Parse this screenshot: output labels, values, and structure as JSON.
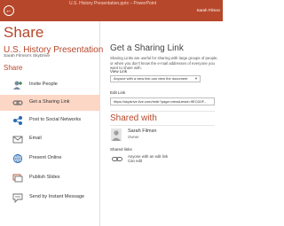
{
  "titlebar": {
    "doc_title": "U.S. History Presentation.pptx – PowerPoint",
    "user": "Sarah Filmsn"
  },
  "sidebar": {
    "heading": "Share",
    "presentation_title": "U.S. History Presentation",
    "presentation_path": "Sarah Filmsn's SkyDrive",
    "section_label": "Share",
    "items": [
      {
        "label": "Invite People",
        "icon": "invite-people-icon"
      },
      {
        "label": "Get a Sharing Link",
        "icon": "sharing-link-icon",
        "selected": true
      },
      {
        "label": "Post to Social Networks",
        "icon": "social-networks-icon"
      },
      {
        "label": "Email",
        "icon": "email-icon"
      },
      {
        "label": "Present Online",
        "icon": "present-online-icon"
      },
      {
        "label": "Publish Slides",
        "icon": "publish-slides-icon"
      },
      {
        "label": "Send by Instant Message",
        "icon": "instant-message-icon"
      }
    ]
  },
  "main": {
    "heading": "Get a Sharing Link",
    "description": "Sharing Links are useful for sharing with large groups of people, or when you don't know the e-mail addresses of everyone you want to share with.",
    "view_link_label": "View Link",
    "view_link_value": "Anyone with a view link can view the document",
    "edit_link_label": "Edit Link",
    "edit_link_value": "https://skydrive.live.com/redir?page=view&resid=9ECD0F...",
    "shared_with_heading": "Shared with",
    "person_name": "Sarah Filmsn",
    "person_role": "Owner",
    "shared_links_label": "Shared links",
    "shared_link_desc": "Anyone with an edit link\nCan edit"
  },
  "colors": {
    "accent": "#b7472a",
    "selected_bg": "#fcd7c5"
  }
}
